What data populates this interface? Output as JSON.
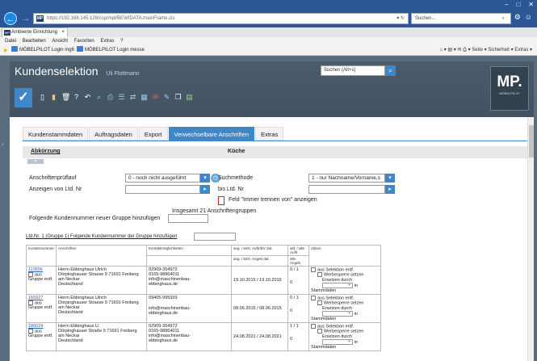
{
  "browser": {
    "url": "https://192.168.145.128/csp/mpl/BEWIDATA.mainFrame.cls",
    "search_placeholder": "Suchen...",
    "tab_title": "Ambiente Einrichtung",
    "menu": [
      "Datei",
      "Bearbeiten",
      "Ansicht",
      "Favoriten",
      "Extras",
      "?"
    ],
    "favorites": [
      "MÖBELPILOT Login mg6",
      "MÖBELPILOT Login messe"
    ],
    "command_bar": "Seite ▾  Sicherheit ▾  Extras ▾"
  },
  "header": {
    "title": "Kundenselektion",
    "user": "Uli Flottmann",
    "search_value": "Suchen (Alt+s)",
    "logo": "MP.",
    "logo_sub": "MÖBELPILOT"
  },
  "tabs": [
    "Kundenstammdaten",
    "Auftragsdaten",
    "Export",
    "Verwechselbare Anschriften",
    "Extras"
  ],
  "active_tab": "Verwechselbare Anschriften",
  "form": {
    "abbrev_label": "Abkürzung",
    "abbrev_value": "Küche",
    "check_label": "Anschriftenprüflauf",
    "check_value": "0 - noch nicht ausgeführt",
    "search_method_label": "Suchmethode",
    "search_method_value": "1 - nur Nachname/Vorname,s",
    "from_label": "Anzeigen von Ltd. Nr",
    "from_value": "",
    "to_label": "bis Ltd. Nr",
    "to_value": "",
    "never_separate_label": "Feld \"Immer trennen von\" anzeigen",
    "total_groups": "Insgesamt 21 Anschriftengruppen",
    "add_group_label": "Folgende Kundennummer neuer Gruppe hinzufügen",
    "group1_label": "Ltd.Nr. 1 (Gruppe 1) Folgende Kundennummer der Gruppe hinzufügen"
  },
  "table": {
    "headers": [
      "Kundennummer",
      "Anschriften",
      "Kontaktmöglichkeiten",
      "ang. / letzt. Auftr/BV dat.",
      "ald. / alle Auftr.",
      "Aktion"
    ],
    "sub_headers": [
      "ang. / letzt. Angeb dat.",
      "alle Angeb."
    ],
    "rows": [
      {
        "nr": "113656",
        "cb_label": "aus Gruppe entf.",
        "address": [
          "Herrn Ebbinghaus Ulrich",
          "Dörpinghauser Strasse 9 71691 Freiberg",
          "am Neckar",
          "Deutschland"
        ],
        "contact": [
          "02909-354972",
          "0165-98864011",
          "info@maschinenbau-",
          "ebbinghaus.de"
        ],
        "dates": "19.10.2015 / 19.10.2015",
        "count": "0 / 1",
        "angeb": "0"
      },
      {
        "nr": "165927",
        "cb_label": "aus Gruppe entf.",
        "address": [
          "Herrn Ebbinghaus Ulrich",
          "Dörpinghauser Strasse 9 71691 Freiberg",
          "am Neckar",
          "Deutschland"
        ],
        "contact": [
          "09405-995939",
          "",
          "info@maschinenbau-",
          "ebbinghaus.de"
        ],
        "dates": "08.06.2015 / 08.06.2015",
        "count": "0 / 1",
        "angeb": "0"
      },
      {
        "nr": "186024",
        "cb_label": "aus Gruppe entf.",
        "address": [
          "Herrn Ebbinghaus U.",
          "Dörpinghauser Straße 9 71691 Freiberg",
          "am Neckar",
          "Deutschland"
        ],
        "contact": [
          "02909-354972",
          "0165-98864011",
          "info@maschinenbau-",
          "ebbinghaus.de"
        ],
        "dates": "24.08.2021 / 24.08.2021",
        "count": "1 / 1",
        "angeb": "0"
      }
    ],
    "action": {
      "remove": "aus Selektion entf.",
      "ad": "Werbesperre setzen",
      "replace": "Ersetzen durch",
      "in": "in",
      "master": "Stammdaten"
    }
  }
}
